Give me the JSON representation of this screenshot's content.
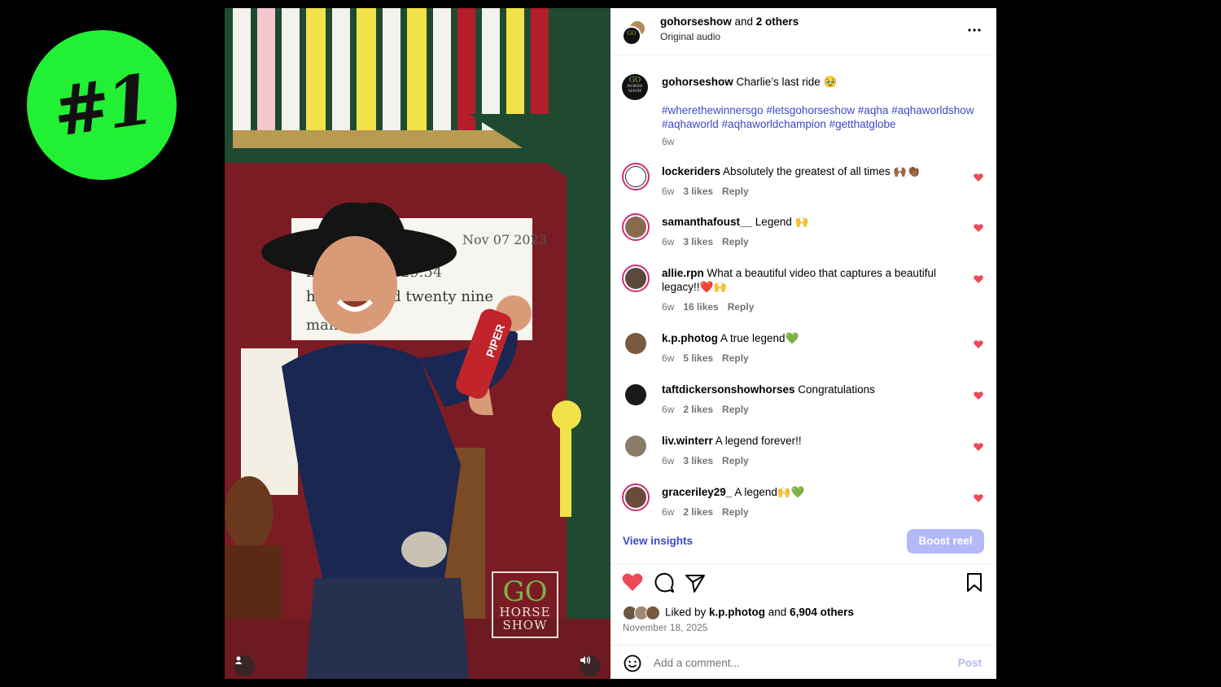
{
  "rank": "#1",
  "video": {
    "watermark_line1": "GO",
    "watermark_line2": "HORSE",
    "watermark_line3": "SHOW"
  },
  "header": {
    "username": "gohorseshow",
    "and_others": " and ",
    "others": "2 others",
    "audio": "Original audio"
  },
  "caption": {
    "username": "gohorseshow",
    "text": " Charlie’s last ride 🥹",
    "hashtags": "#wherethewinnersgo #letsgohorseshow #aqha #aqhaworldshow #aqhaworld #aqhaworldchampion #getthatglobe",
    "time": "6w"
  },
  "comments": [
    {
      "user": "lockeriders",
      "text": " Absolutely the greatest of all times 🙌🏾👏🏾",
      "time": "6w",
      "likes": "3 likes",
      "reply": "Reply"
    },
    {
      "user": "samanthafoust__",
      "text": " Legend 🙌",
      "time": "6w",
      "likes": "3 likes",
      "reply": "Reply"
    },
    {
      "user": "allie.rpn",
      "text": " What a beautiful video that captures a beautiful legacy!!❤️🙌",
      "time": "6w",
      "likes": "16 likes",
      "reply": "Reply"
    },
    {
      "user": "k.p.photog",
      "text": " A true legend💚",
      "time": "6w",
      "likes": "5 likes",
      "reply": "Reply"
    },
    {
      "user": "taftdickersonshowhorses",
      "text": " Congratulations",
      "time": "6w",
      "likes": "2 likes",
      "reply": "Reply"
    },
    {
      "user": "liv.winterr",
      "text": " A legend forever!!",
      "time": "6w",
      "likes": "3 likes",
      "reply": "Reply"
    },
    {
      "user": "graceriley29_",
      "text": " A legend🙌💚",
      "time": "6w",
      "likes": "2 likes",
      "reply": "Reply"
    }
  ],
  "insights": {
    "view_label": "View insights",
    "boost_label": "Boost reel"
  },
  "likes": {
    "prefix": "Liked by ",
    "user": "k.p.photog",
    "middle": " and ",
    "others": "6,904 others"
  },
  "date": "November 18, 2025",
  "comment_box": {
    "placeholder": "Add a comment...",
    "post_label": "Post"
  },
  "colors": {
    "accent": "#3b4ac6",
    "like_red": "#ed4956",
    "badge_green": "#22f034",
    "boost_disabled": "#b3b9f7"
  }
}
